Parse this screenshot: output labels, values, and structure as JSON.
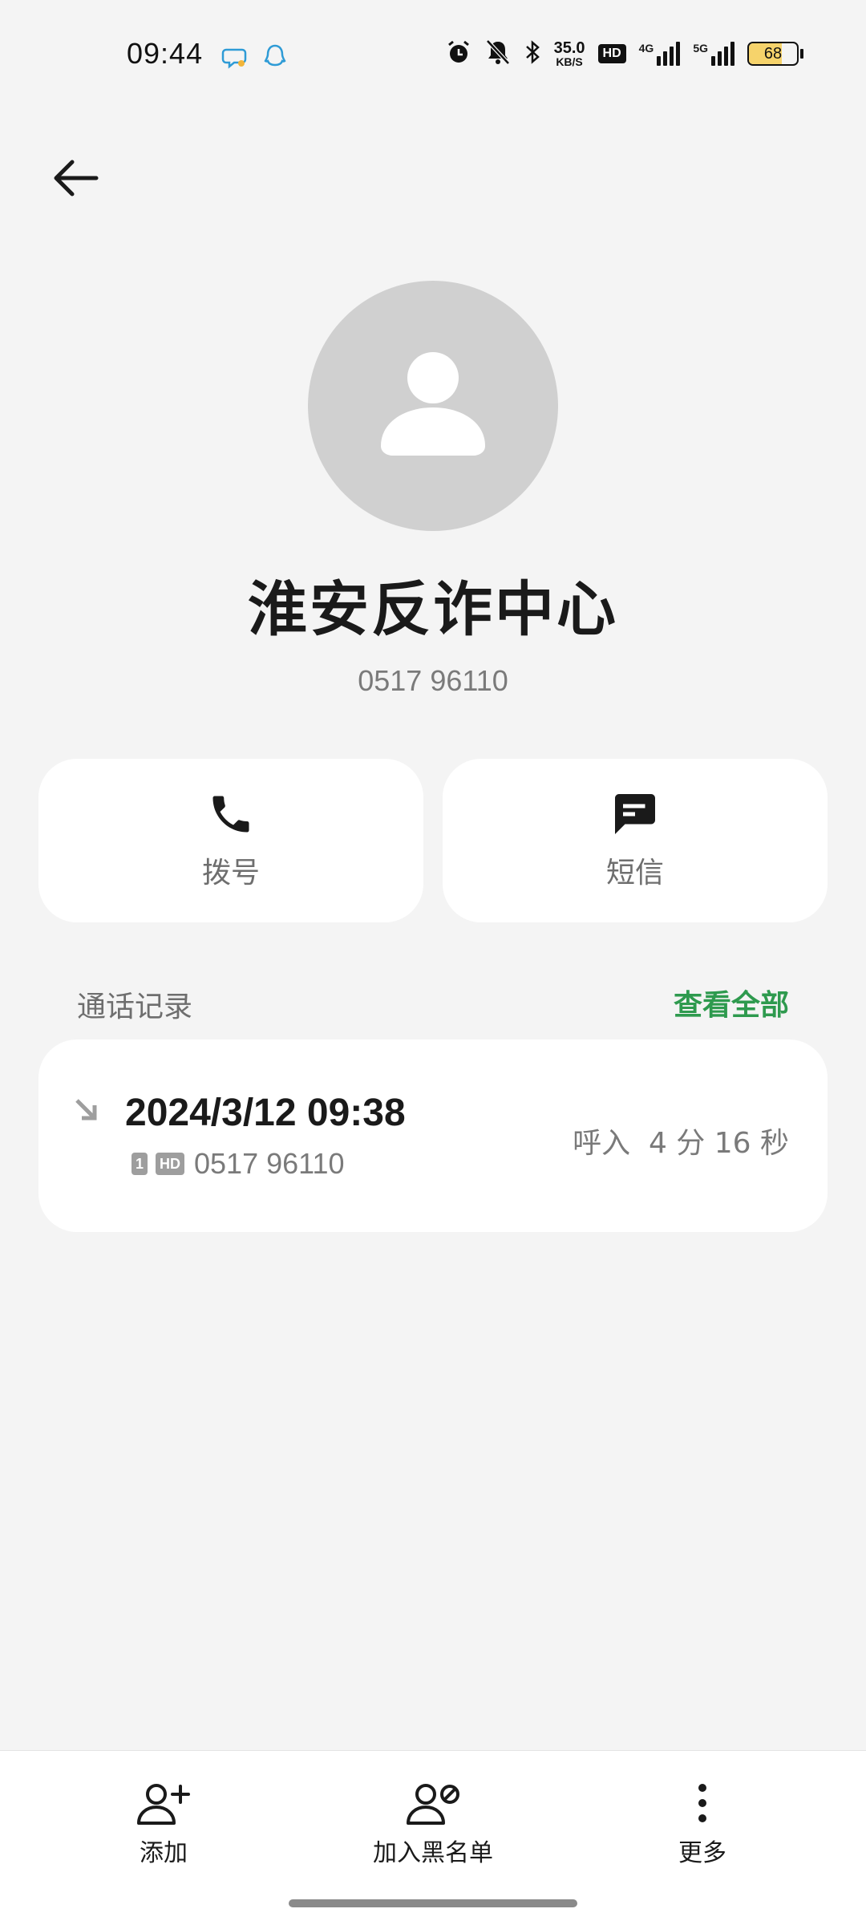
{
  "status_bar": {
    "time": "09:44",
    "net_speed_value": "35.0",
    "net_speed_unit": "KB/S",
    "hd_label": "HD",
    "sim1_label": "4G",
    "sim2_label": "5G",
    "battery_level": "68",
    "battery_fraction": 0.68,
    "icons": [
      "chat-app-icon",
      "qq-app-icon",
      "alarm-icon",
      "mute-bell-icon",
      "bluetooth-icon",
      "hd-icon",
      "signal-icon",
      "signal-icon",
      "battery-icon"
    ]
  },
  "contact": {
    "name": "淮安反诈中心",
    "number": "0517 96110"
  },
  "actions": {
    "call_label": "拨号",
    "sms_label": "短信"
  },
  "call_log": {
    "title": "通话记录",
    "view_all": "查看全部",
    "entries": [
      {
        "datetime": "2024/3/12 09:38",
        "sim_tag": "1",
        "hd_tag": "HD",
        "number": "0517 96110",
        "status": "呼入  4 分 16 秒"
      }
    ]
  },
  "bottom_bar": {
    "add_label": "添加",
    "block_label": "加入黑名单",
    "more_label": "更多"
  },
  "colors": {
    "accent_green": "#2e9a4e",
    "background": "#f4f4f4",
    "avatar_bg": "#d0d0d0",
    "battery_fill": "#f6d36b"
  }
}
